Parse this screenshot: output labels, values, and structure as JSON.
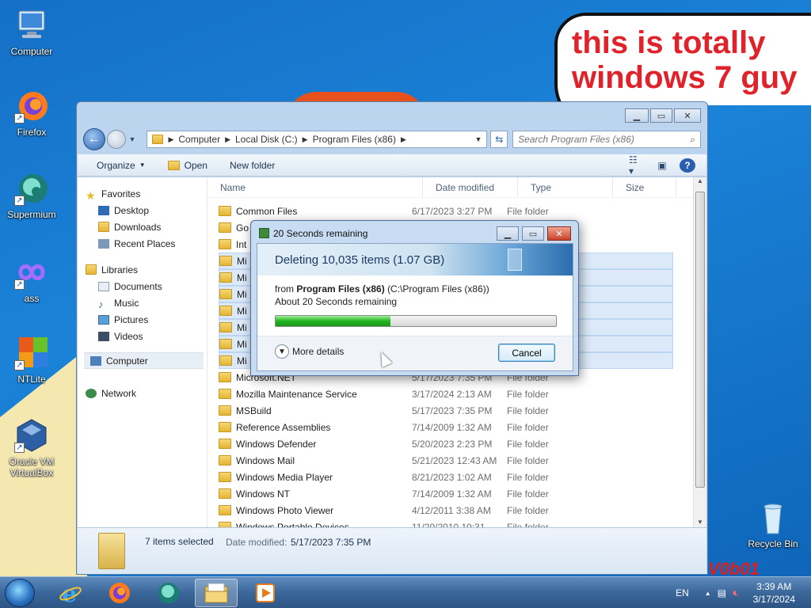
{
  "desktop": {
    "icons": [
      {
        "label": "Computer"
      },
      {
        "label": "Firefox"
      },
      {
        "label": "Supermium"
      },
      {
        "label": "ass"
      },
      {
        "label": "NTLite"
      },
      {
        "label": "Oracle VM VirtualBox"
      },
      {
        "label": "Recycle Bin"
      }
    ],
    "speech_text_line1": "this is totally",
    "speech_text_line2": "windows 7 guy",
    "corner_text": "V0b01",
    "colors": {
      "speech_text": "#e0232a"
    }
  },
  "explorer": {
    "breadcrumbs": [
      "Computer",
      "Local Disk (C:)",
      "Program Files (x86)"
    ],
    "search_placeholder": "Search Program Files (x86)",
    "toolbar": {
      "organize": "Organize",
      "open": "Open",
      "new_folder": "New folder"
    },
    "nav": {
      "favorites": "Favorites",
      "desktop": "Desktop",
      "downloads": "Downloads",
      "recent": "Recent Places",
      "libraries": "Libraries",
      "documents": "Documents",
      "music": "Music",
      "pictures": "Pictures",
      "videos": "Videos",
      "computer": "Computer",
      "network": "Network"
    },
    "columns": {
      "name": "Name",
      "date": "Date modified",
      "type": "Type",
      "size": "Size"
    },
    "rows": [
      {
        "name": "Common Files",
        "date": "6/17/2023 3:27 PM",
        "type": "File folder"
      },
      {
        "name": "Go",
        "date": "",
        "type": ""
      },
      {
        "name": "Int",
        "date": "",
        "type": ""
      },
      {
        "name": "Mi",
        "date": "",
        "type": ""
      },
      {
        "name": "Mi",
        "date": "",
        "type": ""
      },
      {
        "name": "Mi",
        "date": "",
        "type": ""
      },
      {
        "name": "Mi",
        "date": "",
        "type": ""
      },
      {
        "name": "Mi",
        "date": "",
        "type": ""
      },
      {
        "name": "Mi",
        "date": "",
        "type": ""
      },
      {
        "name": "Mi",
        "date": "",
        "type": ""
      },
      {
        "name": "Microsoft.NET",
        "date": "5/17/2023 7:35 PM",
        "type": "File folder"
      },
      {
        "name": "Mozilla Maintenance Service",
        "date": "3/17/2024 2:13 AM",
        "type": "File folder"
      },
      {
        "name": "MSBuild",
        "date": "5/17/2023 7:35 PM",
        "type": "File folder"
      },
      {
        "name": "Reference Assemblies",
        "date": "7/14/2009 1:32 AM",
        "type": "File folder"
      },
      {
        "name": "Windows Defender",
        "date": "5/20/2023 2:23 PM",
        "type": "File folder"
      },
      {
        "name": "Windows Mail",
        "date": "5/21/2023 12:43 AM",
        "type": "File folder"
      },
      {
        "name": "Windows Media Player",
        "date": "8/21/2023 1:02 AM",
        "type": "File folder"
      },
      {
        "name": "Windows NT",
        "date": "7/14/2009 1:32 AM",
        "type": "File folder"
      },
      {
        "name": "Windows Photo Viewer",
        "date": "4/12/2011 3:38 AM",
        "type": "File folder"
      },
      {
        "name": "Windows Portable Devices",
        "date": "11/20/2010 10:31",
        "type": "File folder"
      }
    ],
    "details": {
      "selected": "7 items selected",
      "date_label": "Date modified:",
      "date_value": "5/17/2023 7:35 PM"
    }
  },
  "dialog": {
    "title": "20 Seconds remaining",
    "banner": "Deleting 10,035 items (1.07 GB)",
    "from_prefix": "from",
    "from_name": "Program Files (x86)",
    "from_path": "(C:\\Program Files (x86))",
    "remaining": "About 20 Seconds remaining",
    "progress": 0.41,
    "more_details": "More details",
    "cancel": "Cancel"
  },
  "taskbar": {
    "lang": "EN",
    "time": "3:39 AM",
    "date": "3/17/2024"
  }
}
